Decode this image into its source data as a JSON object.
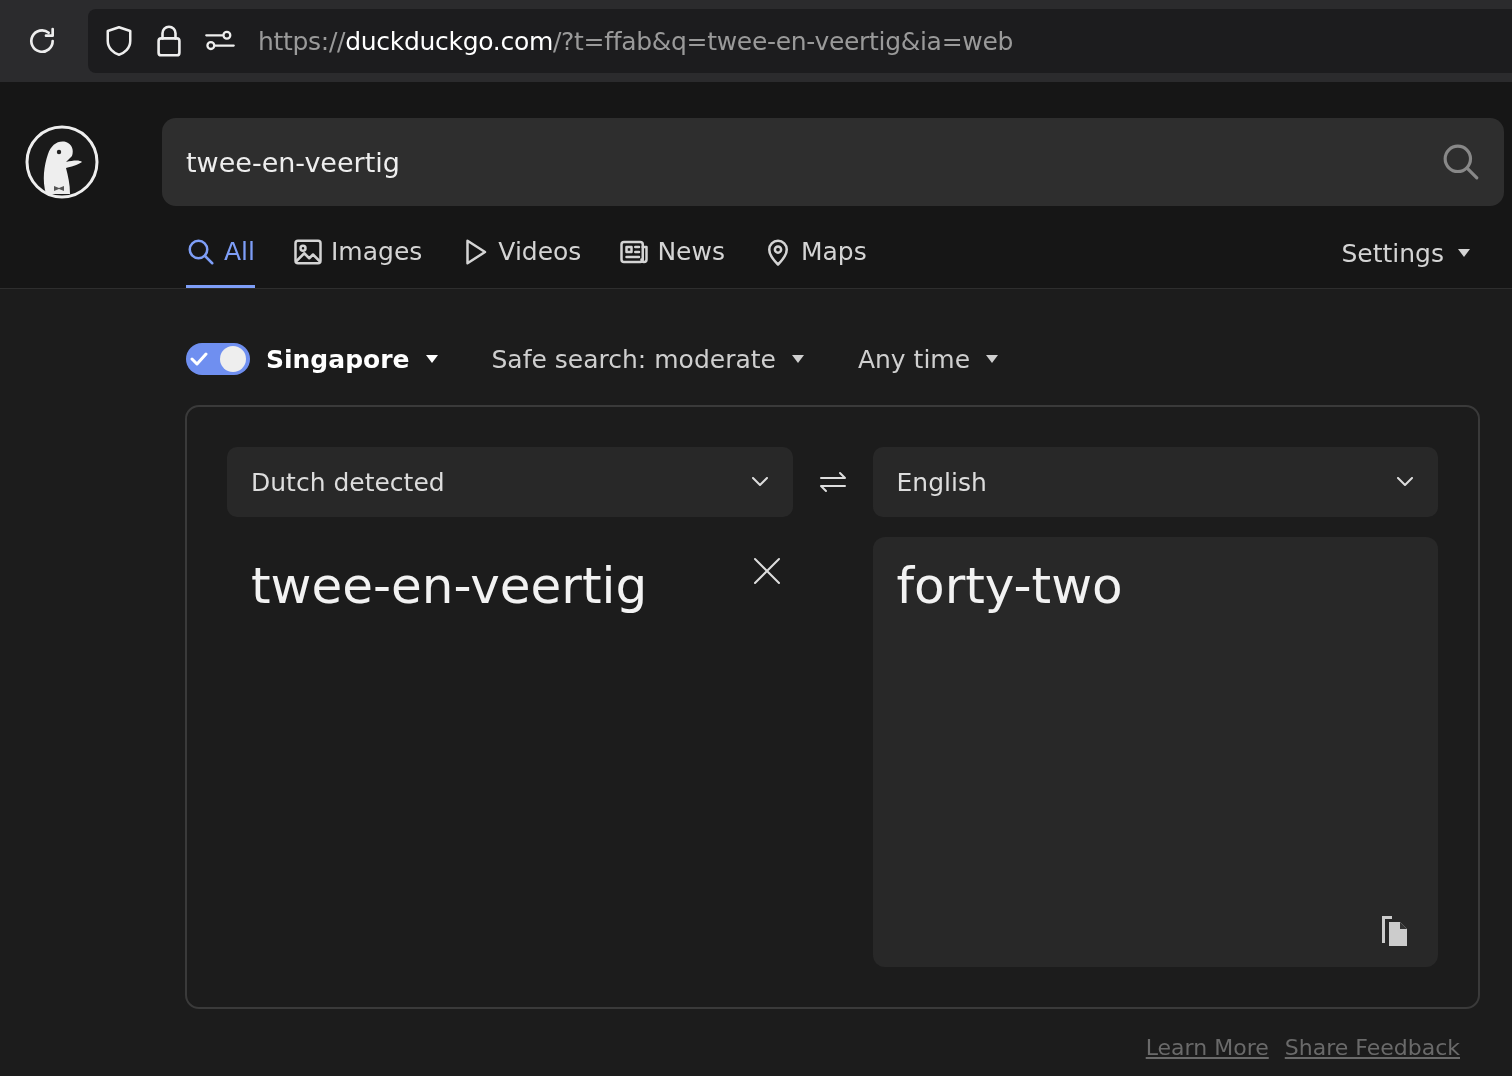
{
  "browser": {
    "url": {
      "scheme": "https://",
      "host": "duckduckgo.com",
      "rest": "/?t=ffab&q=twee-en-veertig&ia=web"
    }
  },
  "search": {
    "value": "twee-en-veertig"
  },
  "tabs": [
    {
      "label": "All",
      "kind": "all",
      "selected": true
    },
    {
      "label": "Images",
      "kind": "images",
      "selected": false
    },
    {
      "label": "Videos",
      "kind": "videos",
      "selected": false
    },
    {
      "label": "News",
      "kind": "news",
      "selected": false
    },
    {
      "label": "Maps",
      "kind": "maps",
      "selected": false
    }
  ],
  "settings": {
    "label": "Settings"
  },
  "filters": {
    "region": {
      "label": "Singapore",
      "on": true
    },
    "items": [
      "Safe search: moderate",
      "Any time"
    ]
  },
  "translator": {
    "source_language": "Dutch detected",
    "target_language": "English",
    "source_text": "twee-en-veertig",
    "translation": "forty-two"
  },
  "footer_links": [
    "Learn More",
    "Share Feedback"
  ]
}
